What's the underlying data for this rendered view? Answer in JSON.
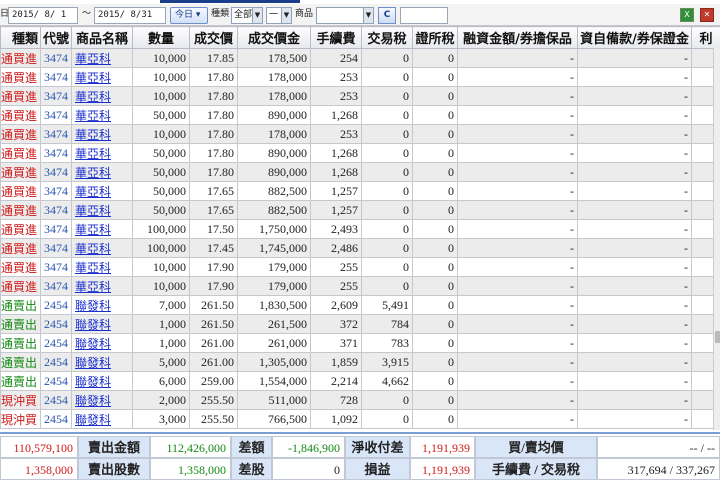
{
  "toolbar": {
    "date_label": "日期",
    "date_from": "2015/ 8/ 1",
    "date_to": "2015/ 8/31",
    "date_sep": "～",
    "today_button": "今日",
    "type_label": "種類",
    "type_value": "全部",
    "dash_value": "一",
    "product_label": "商品",
    "product_value": "",
    "c_button": "C",
    "extra_value": ""
  },
  "table": {
    "columns": [
      "種類",
      "代號",
      "商品名稱",
      "數量",
      "成交價",
      "成交價金",
      "手續費",
      "交易稅",
      "證所稅",
      "融資金額/券擔保品",
      "資自備款/券保證金",
      "利"
    ],
    "rows": [
      {
        "type": "普通買進",
        "side": "buy",
        "code": "3474",
        "name": "華亞科",
        "qty": "10,000",
        "price": "17.85",
        "amount": "178,500",
        "fee": "254",
        "tax": "0",
        "cgt": "0",
        "margin": "-",
        "deposit": "-"
      },
      {
        "type": "普通買進",
        "side": "buy",
        "code": "3474",
        "name": "華亞科",
        "qty": "10,000",
        "price": "17.80",
        "amount": "178,000",
        "fee": "253",
        "tax": "0",
        "cgt": "0",
        "margin": "-",
        "deposit": "-"
      },
      {
        "type": "普通買進",
        "side": "buy",
        "code": "3474",
        "name": "華亞科",
        "qty": "10,000",
        "price": "17.80",
        "amount": "178,000",
        "fee": "253",
        "tax": "0",
        "cgt": "0",
        "margin": "-",
        "deposit": "-"
      },
      {
        "type": "普通買進",
        "side": "buy",
        "code": "3474",
        "name": "華亞科",
        "qty": "50,000",
        "price": "17.80",
        "amount": "890,000",
        "fee": "1,268",
        "tax": "0",
        "cgt": "0",
        "margin": "-",
        "deposit": "-"
      },
      {
        "type": "普通買進",
        "side": "buy",
        "code": "3474",
        "name": "華亞科",
        "qty": "10,000",
        "price": "17.80",
        "amount": "178,000",
        "fee": "253",
        "tax": "0",
        "cgt": "0",
        "margin": "-",
        "deposit": "-"
      },
      {
        "type": "普通買進",
        "side": "buy",
        "code": "3474",
        "name": "華亞科",
        "qty": "50,000",
        "price": "17.80",
        "amount": "890,000",
        "fee": "1,268",
        "tax": "0",
        "cgt": "0",
        "margin": "-",
        "deposit": "-"
      },
      {
        "type": "普通買進",
        "side": "buy",
        "code": "3474",
        "name": "華亞科",
        "qty": "50,000",
        "price": "17.80",
        "amount": "890,000",
        "fee": "1,268",
        "tax": "0",
        "cgt": "0",
        "margin": "-",
        "deposit": "-"
      },
      {
        "type": "普通買進",
        "side": "buy",
        "code": "3474",
        "name": "華亞科",
        "qty": "50,000",
        "price": "17.65",
        "amount": "882,500",
        "fee": "1,257",
        "tax": "0",
        "cgt": "0",
        "margin": "-",
        "deposit": "-"
      },
      {
        "type": "普通買進",
        "side": "buy",
        "code": "3474",
        "name": "華亞科",
        "qty": "50,000",
        "price": "17.65",
        "amount": "882,500",
        "fee": "1,257",
        "tax": "0",
        "cgt": "0",
        "margin": "-",
        "deposit": "-"
      },
      {
        "type": "普通買進",
        "side": "buy",
        "code": "3474",
        "name": "華亞科",
        "qty": "100,000",
        "price": "17.50",
        "amount": "1,750,000",
        "fee": "2,493",
        "tax": "0",
        "cgt": "0",
        "margin": "-",
        "deposit": "-"
      },
      {
        "type": "普通買進",
        "side": "buy",
        "code": "3474",
        "name": "華亞科",
        "qty": "100,000",
        "price": "17.45",
        "amount": "1,745,000",
        "fee": "2,486",
        "tax": "0",
        "cgt": "0",
        "margin": "-",
        "deposit": "-"
      },
      {
        "type": "普通買進",
        "side": "buy",
        "code": "3474",
        "name": "華亞科",
        "qty": "10,000",
        "price": "17.90",
        "amount": "179,000",
        "fee": "255",
        "tax": "0",
        "cgt": "0",
        "margin": "-",
        "deposit": "-"
      },
      {
        "type": "普通買進",
        "side": "buy",
        "code": "3474",
        "name": "華亞科",
        "qty": "10,000",
        "price": "17.90",
        "amount": "179,000",
        "fee": "255",
        "tax": "0",
        "cgt": "0",
        "margin": "-",
        "deposit": "-"
      },
      {
        "type": "普通賣出",
        "side": "sell",
        "code": "2454",
        "name": "聯發科",
        "qty": "7,000",
        "price": "261.50",
        "amount": "1,830,500",
        "fee": "2,609",
        "tax": "5,491",
        "cgt": "0",
        "margin": "-",
        "deposit": "-"
      },
      {
        "type": "普通賣出",
        "side": "sell",
        "code": "2454",
        "name": "聯發科",
        "qty": "1,000",
        "price": "261.50",
        "amount": "261,500",
        "fee": "372",
        "tax": "784",
        "cgt": "0",
        "margin": "-",
        "deposit": "-"
      },
      {
        "type": "普通賣出",
        "side": "sell",
        "code": "2454",
        "name": "聯發科",
        "qty": "1,000",
        "price": "261.00",
        "amount": "261,000",
        "fee": "371",
        "tax": "783",
        "cgt": "0",
        "margin": "-",
        "deposit": "-"
      },
      {
        "type": "普通賣出",
        "side": "sell",
        "code": "2454",
        "name": "聯發科",
        "qty": "5,000",
        "price": "261.00",
        "amount": "1,305,000",
        "fee": "1,859",
        "tax": "3,915",
        "cgt": "0",
        "margin": "-",
        "deposit": "-"
      },
      {
        "type": "普通賣出",
        "side": "sell",
        "code": "2454",
        "name": "聯發科",
        "qty": "6,000",
        "price": "259.00",
        "amount": "1,554,000",
        "fee": "2,214",
        "tax": "4,662",
        "cgt": "0",
        "margin": "-",
        "deposit": "-"
      },
      {
        "type": "現沖買",
        "side": "buy",
        "code": "2454",
        "name": "聯發科",
        "qty": "2,000",
        "price": "255.50",
        "amount": "511,000",
        "fee": "728",
        "tax": "0",
        "cgt": "0",
        "margin": "-",
        "deposit": "-"
      },
      {
        "type": "現沖買",
        "side": "buy",
        "code": "2454",
        "name": "聯發科",
        "qty": "3,000",
        "price": "255.50",
        "amount": "766,500",
        "fee": "1,092",
        "tax": "0",
        "cgt": "0",
        "margin": "-",
        "deposit": "-"
      }
    ]
  },
  "summary": {
    "buy_amount": "110,579,100",
    "sell_amount_label": "賣出金額",
    "sell_amount": "112,426,000",
    "diff_amount_label": "差額",
    "diff_amount": "-1,846,900",
    "net_label": "淨收付差",
    "net_value": "1,191,939",
    "avg_label": "買/賣均價",
    "avg_value": "-- / --",
    "buy_shares": "1,358,000",
    "sell_shares_label": "賣出股數",
    "sell_shares": "1,358,000",
    "diff_shares_label": "差股",
    "diff_shares": "0",
    "pnl_label": "損益",
    "pnl_value": "1,191,939",
    "fee_tax_label": "手續費 / 交易稅",
    "fee_tax_value": "317,694 / 337,267"
  },
  "colors": {
    "buy": "#d11a1a",
    "sell": "#138a13",
    "link": "#1a2fd0",
    "code": "#2a55b0",
    "header_blue": "#d9e6f7"
  }
}
